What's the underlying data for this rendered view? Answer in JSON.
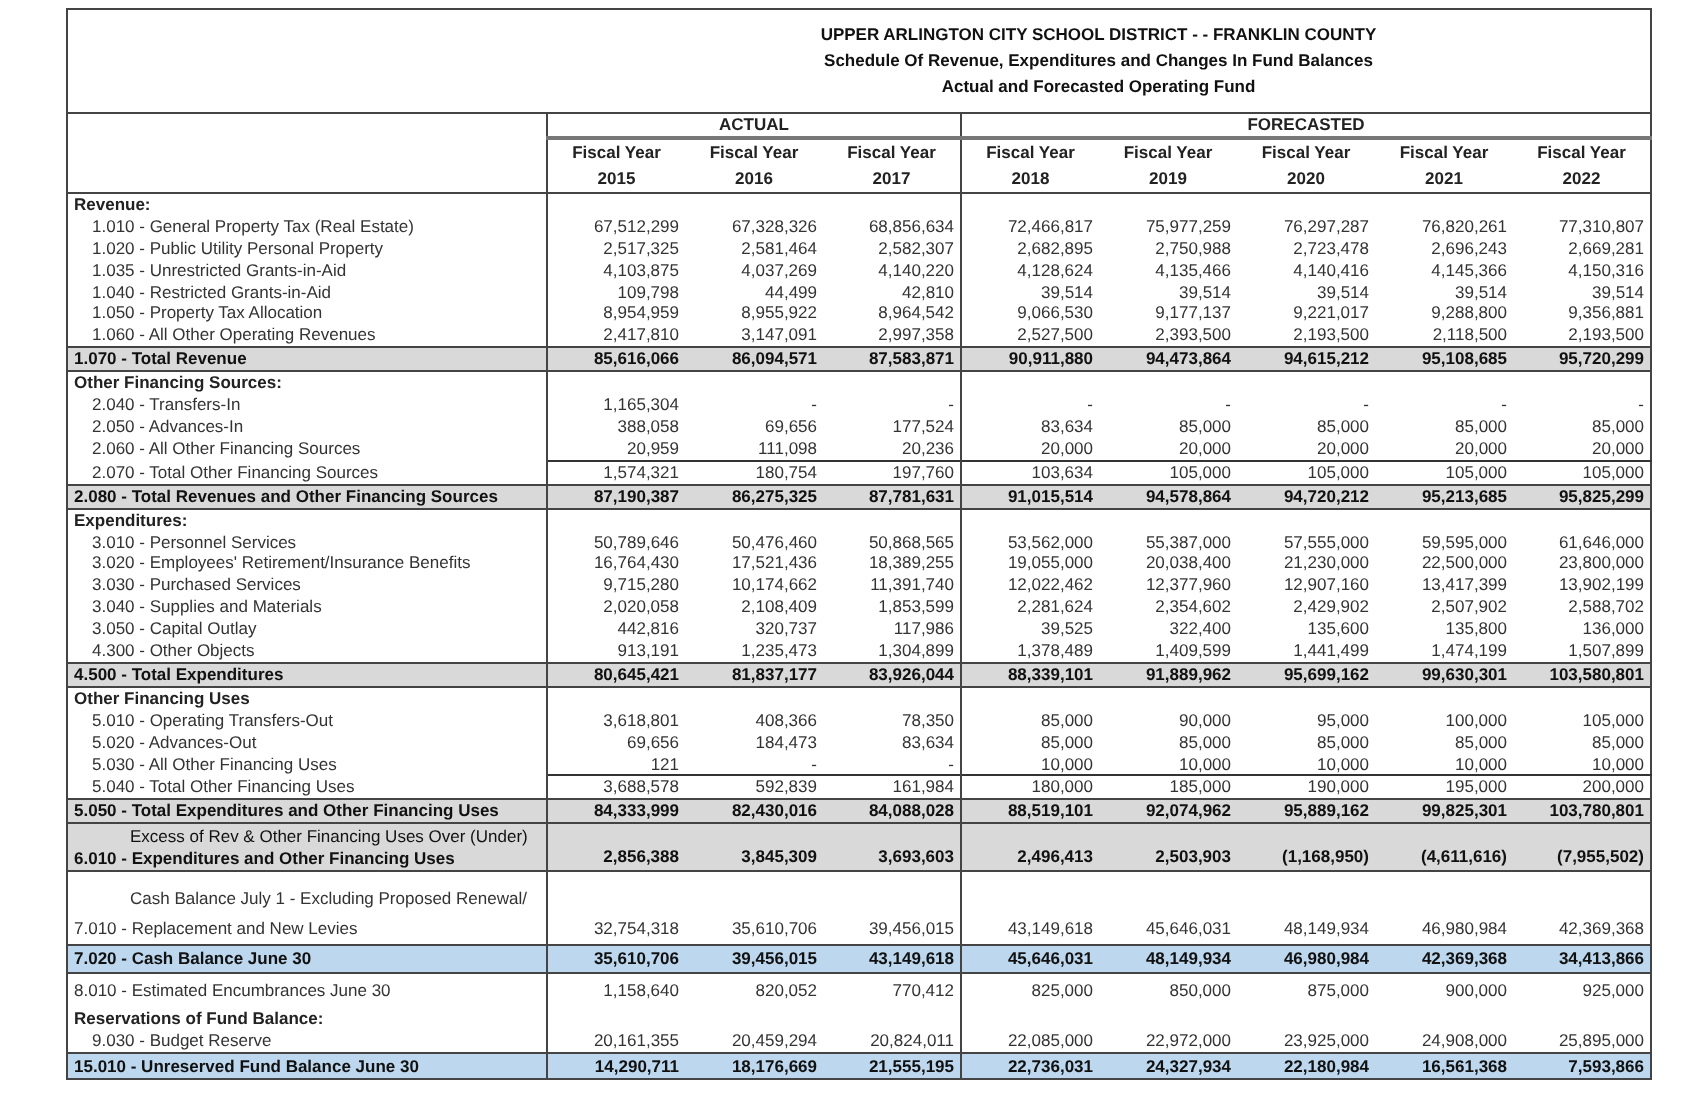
{
  "title_lines": [
    "UPPER ARLINGTON CITY SCHOOL DISTRICT - - FRANKLIN COUNTY",
    "Schedule Of Revenue, Expenditures and Changes In Fund Balances",
    "Actual and Forecasted Operating Fund"
  ],
  "column_groups": [
    {
      "label": "ACTUAL",
      "columns": [
        {
          "heading": "Fiscal Year",
          "year": "2015"
        },
        {
          "heading": "Fiscal Year",
          "year": "2016"
        },
        {
          "heading": "Fiscal Year",
          "year": "2017"
        }
      ]
    },
    {
      "label": "FORECASTED",
      "columns": [
        {
          "heading": "Fiscal Year",
          "year": "2018"
        },
        {
          "heading": "Fiscal Year",
          "year": "2019"
        },
        {
          "heading": "Fiscal Year",
          "year": "2020"
        },
        {
          "heading": "Fiscal Year",
          "year": "2021"
        },
        {
          "heading": "Fiscal Year",
          "year": "2022"
        }
      ]
    }
  ],
  "rows": [
    {
      "kind": "section",
      "label": "Revenue:"
    },
    {
      "kind": "item",
      "label": "1.010 - General Property Tax (Real Estate)",
      "values": [
        "67,512,299",
        "67,328,326",
        "68,856,634",
        "72,466,817",
        "75,977,259",
        "76,297,287",
        "76,820,261",
        "77,310,807"
      ]
    },
    {
      "kind": "item",
      "label": "1.020 - Public Utility Personal Property",
      "values": [
        "2,517,325",
        "2,581,464",
        "2,582,307",
        "2,682,895",
        "2,750,988",
        "2,723,478",
        "2,696,243",
        "2,669,281"
      ]
    },
    {
      "kind": "item",
      "label": "1.035 - Unrestricted Grants-in-Aid",
      "values": [
        "4,103,875",
        "4,037,269",
        "4,140,220",
        "4,128,624",
        "4,135,466",
        "4,140,416",
        "4,145,366",
        "4,150,316"
      ]
    },
    {
      "kind": "item",
      "label": "1.040 - Restricted Grants-in-Aid",
      "values": [
        "109,798",
        "44,499",
        "42,810",
        "39,514",
        "39,514",
        "39,514",
        "39,514",
        "39,514"
      ]
    },
    {
      "kind": "item",
      "label": "1.050 - Property Tax Allocation",
      "values": [
        "8,954,959",
        "8,955,922",
        "8,964,542",
        "9,066,530",
        "9,177,137",
        "9,221,017",
        "9,288,800",
        "9,356,881"
      ]
    },
    {
      "kind": "item",
      "label": "1.060 - All Other Operating Revenues",
      "values": [
        "2,417,810",
        "3,147,091",
        "2,997,358",
        "2,527,500",
        "2,393,500",
        "2,193,500",
        "2,118,500",
        "2,193,500"
      ]
    },
    {
      "kind": "total",
      "label": "1.070 - Total Revenue",
      "values": [
        "85,616,066",
        "86,094,571",
        "87,583,871",
        "90,911,880",
        "94,473,864",
        "94,615,212",
        "95,108,685",
        "95,720,299"
      ]
    },
    {
      "kind": "section",
      "label": "Other Financing Sources:"
    },
    {
      "kind": "item",
      "label": "2.040 - Transfers-In",
      "values": [
        "1,165,304",
        "-",
        "-",
        "-",
        "-",
        "-",
        "-",
        "-"
      ]
    },
    {
      "kind": "item",
      "label": "2.050 - Advances-In",
      "values": [
        "388,058",
        "69,656",
        "177,524",
        "83,634",
        "85,000",
        "85,000",
        "85,000",
        "85,000"
      ]
    },
    {
      "kind": "item",
      "label": "2.060 - All Other Financing Sources",
      "values": [
        "20,959",
        "111,098",
        "20,236",
        "20,000",
        "20,000",
        "20,000",
        "20,000",
        "20,000"
      ]
    },
    {
      "kind": "subtotal",
      "label": "2.070 - Total Other Financing Sources",
      "values": [
        "1,574,321",
        "180,754",
        "197,760",
        "103,634",
        "105,000",
        "105,000",
        "105,000",
        "105,000"
      ]
    },
    {
      "kind": "total",
      "label": "2.080 - Total Revenues and Other Financing Sources",
      "values": [
        "87,190,387",
        "86,275,325",
        "87,781,631",
        "91,015,514",
        "94,578,864",
        "94,720,212",
        "95,213,685",
        "95,825,299"
      ]
    },
    {
      "kind": "section",
      "label": "Expenditures:"
    },
    {
      "kind": "item",
      "label": "3.010 - Personnel Services",
      "values": [
        "50,789,646",
        "50,476,460",
        "50,868,565",
        "53,562,000",
        "55,387,000",
        "57,555,000",
        "59,595,000",
        "61,646,000"
      ]
    },
    {
      "kind": "item",
      "label": "3.020 - Employees' Retirement/Insurance Benefits",
      "values": [
        "16,764,430",
        "17,521,436",
        "18,389,255",
        "19,055,000",
        "20,038,400",
        "21,230,000",
        "22,500,000",
        "23,800,000"
      ]
    },
    {
      "kind": "item",
      "label": "3.030 - Purchased Services",
      "values": [
        "9,715,280",
        "10,174,662",
        "11,391,740",
        "12,022,462",
        "12,377,960",
        "12,907,160",
        "13,417,399",
        "13,902,199"
      ]
    },
    {
      "kind": "item",
      "label": "3.040 - Supplies and Materials",
      "values": [
        "2,020,058",
        "2,108,409",
        "1,853,599",
        "2,281,624",
        "2,354,602",
        "2,429,902",
        "2,507,902",
        "2,588,702"
      ]
    },
    {
      "kind": "item",
      "label": "3.050 - Capital Outlay",
      "values": [
        "442,816",
        "320,737",
        "117,986",
        "39,525",
        "322,400",
        "135,600",
        "135,800",
        "136,000"
      ]
    },
    {
      "kind": "item",
      "label": "4.300 - Other Objects",
      "values": [
        "913,191",
        "1,235,473",
        "1,304,899",
        "1,378,489",
        "1,409,599",
        "1,441,499",
        "1,474,199",
        "1,507,899"
      ]
    },
    {
      "kind": "total",
      "label": "4.500 - Total Expenditures",
      "values": [
        "80,645,421",
        "81,837,177",
        "83,926,044",
        "88,339,101",
        "91,889,962",
        "95,699,162",
        "99,630,301",
        "103,580,801"
      ]
    },
    {
      "kind": "section",
      "label": "Other Financing Uses"
    },
    {
      "kind": "item",
      "label": "5.010 - Operating Transfers-Out",
      "values": [
        "3,618,801",
        "408,366",
        "78,350",
        "85,000",
        "90,000",
        "95,000",
        "100,000",
        "105,000"
      ]
    },
    {
      "kind": "item",
      "label": "5.020 - Advances-Out",
      "values": [
        "69,656",
        "184,473",
        "83,634",
        "85,000",
        "85,000",
        "85,000",
        "85,000",
        "85,000"
      ]
    },
    {
      "kind": "item",
      "label": "5.030 - All Other Financing Uses",
      "values": [
        "121",
        "-",
        "-",
        "10,000",
        "10,000",
        "10,000",
        "10,000",
        "10,000"
      ]
    },
    {
      "kind": "subtotal",
      "label": "5.040 - Total Other Financing Uses",
      "values": [
        "3,688,578",
        "592,839",
        "161,984",
        "180,000",
        "185,000",
        "190,000",
        "195,000",
        "200,000"
      ]
    },
    {
      "kind": "total",
      "label": "5.050 - Total Expenditures and Other Financing Uses",
      "values": [
        "84,333,999",
        "82,430,016",
        "84,088,028",
        "88,519,101",
        "92,074,962",
        "95,889,162",
        "99,825,301",
        "103,780,801"
      ]
    },
    {
      "kind": "excess",
      "note": "Excess of Rev & Other Financing Uses Over (Under)",
      "label": "6.010 - Expenditures and Other Financing Uses",
      "values": [
        "2,856,388",
        "3,845,309",
        "3,693,603",
        "2,496,413",
        "2,503,903",
        "(1,168,950)",
        "(4,611,616)",
        "(7,955,502)"
      ]
    },
    {
      "kind": "carry",
      "note": "Cash Balance July 1 - Excluding Proposed Renewal/",
      "label": "7.010 - Replacement and New Levies",
      "values": [
        "32,754,318",
        "35,610,706",
        "39,456,015",
        "43,149,618",
        "45,646,031",
        "48,149,934",
        "46,980,984",
        "42,369,368"
      ]
    },
    {
      "kind": "balance",
      "label": "7.020 - Cash Balance June 30",
      "values": [
        "35,610,706",
        "39,456,015",
        "43,149,618",
        "45,646,031",
        "48,149,934",
        "46,980,984",
        "42,369,368",
        "34,413,866"
      ]
    },
    {
      "kind": "plain",
      "label": "8.010 - Estimated Encumbrances June 30",
      "values": [
        "1,158,640",
        "820,052",
        "770,412",
        "825,000",
        "850,000",
        "875,000",
        "900,000",
        "925,000"
      ]
    },
    {
      "kind": "section",
      "label": "Reservations of Fund Balance:"
    },
    {
      "kind": "item",
      "label": "9.030 - Budget Reserve",
      "values": [
        "20,161,355",
        "20,459,294",
        "20,824,011",
        "22,085,000",
        "22,972,000",
        "23,925,000",
        "24,908,000",
        "25,895,000"
      ]
    },
    {
      "kind": "balance",
      "label": "15.010 - Unreserved Fund Balance June 30",
      "values": [
        "14,290,711",
        "18,176,669",
        "21,555,195",
        "22,736,031",
        "24,327,934",
        "22,180,984",
        "16,561,368",
        "7,593,866"
      ]
    }
  ]
}
